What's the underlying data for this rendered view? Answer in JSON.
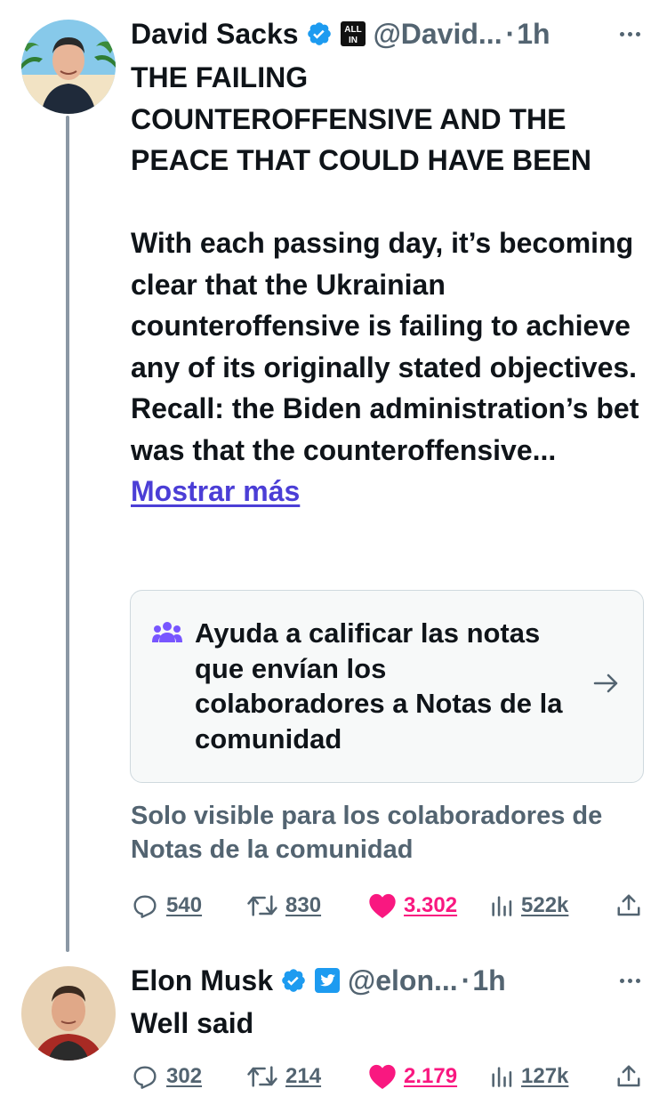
{
  "tweet1": {
    "author": "David Sacks",
    "handle": "@David...",
    "separator": "·",
    "time": "1h",
    "affiliate_badge": "ALL IN",
    "title_lines": [
      "THE FAILING",
      "COUNTEROFFENSIVE AND THE",
      "PEACE THAT COULD HAVE BEEN"
    ],
    "body": "With each passing day, it’s becoming clear that the Ukrainian counteroffensive is failing to achieve any of its originally stated objectives. Recall: the Biden administration’s bet was that the counteroffensive...",
    "show_more": "Mostrar más",
    "community_note": {
      "text": "Ayuda a calificar las notas que envían los colaboradores a Notas de la comunidad",
      "icon": "people-icon"
    },
    "visibility": "Solo visible para los colaboradores de Notas de la comunidad",
    "stats": {
      "replies": "540",
      "reposts": "830",
      "likes": "3.302",
      "views": "522k"
    }
  },
  "tweet2": {
    "author": "Elon Musk",
    "handle": "@elon...",
    "separator": "·",
    "time": "1h",
    "body": "Well said",
    "stats": {
      "replies": "302",
      "reposts": "214",
      "likes": "2.179",
      "views": "127k"
    }
  },
  "colors": {
    "text": "#0f1419",
    "secondary": "#536471",
    "verified": "#1d9bf0",
    "like": "#f91880",
    "link": "#4b3ed6",
    "note_icon": "#7856ff"
  }
}
